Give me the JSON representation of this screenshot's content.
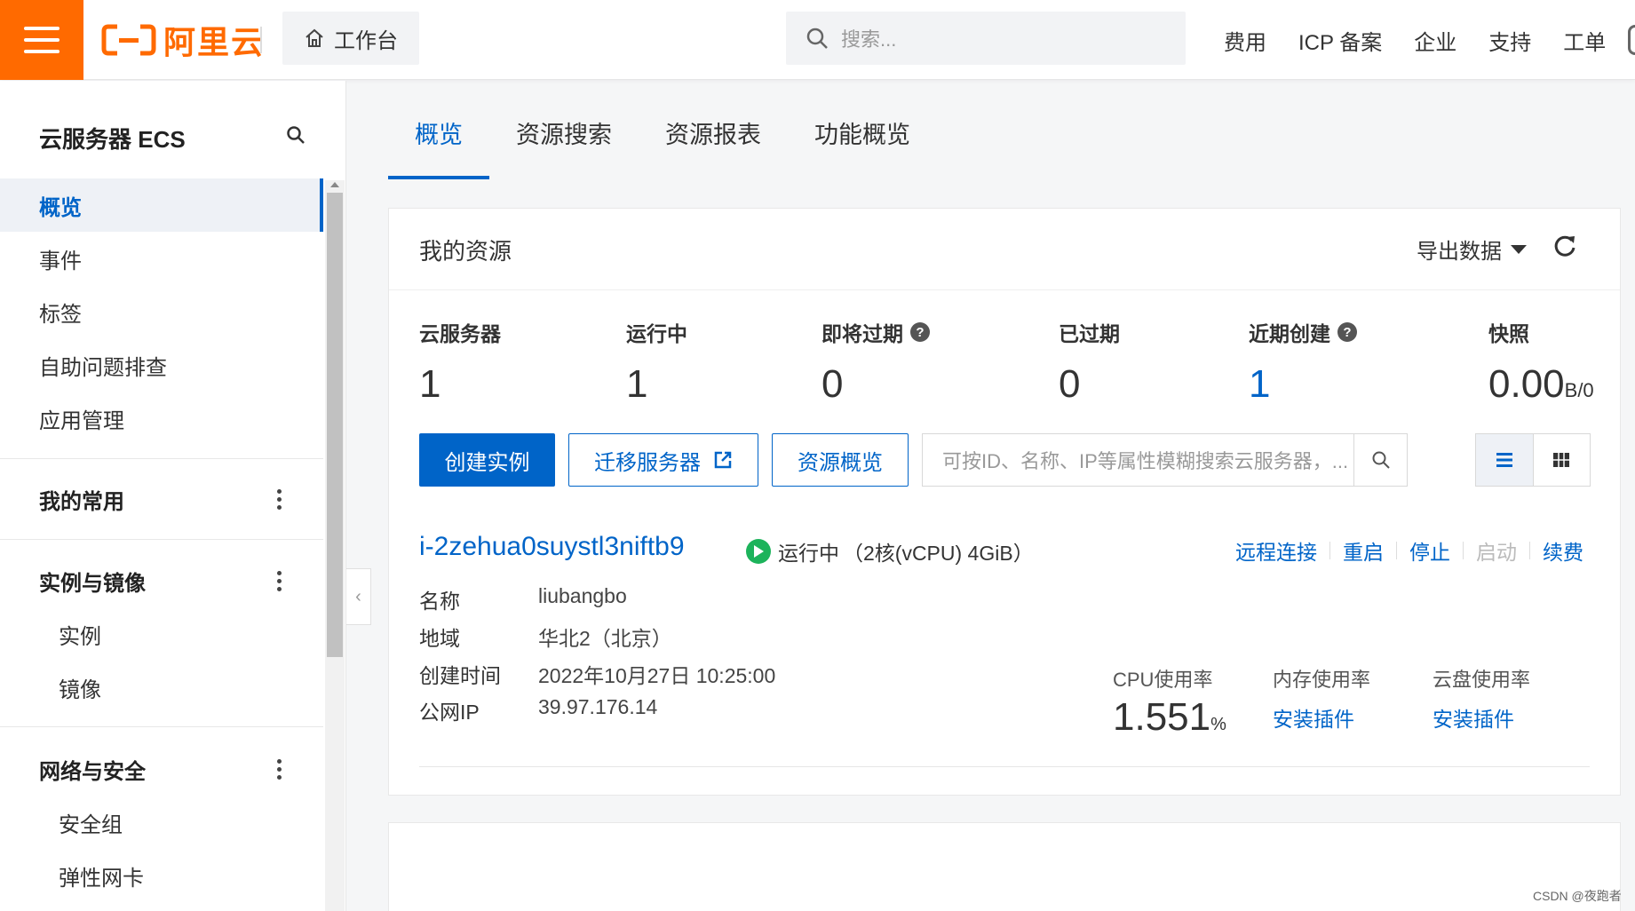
{
  "topbar": {
    "logo_text": "阿里云",
    "workbench_label": "工作台",
    "search_placeholder": "搜索...",
    "nav": [
      "费用",
      "ICP 备案",
      "企业",
      "支持",
      "工单"
    ],
    "brand_color": "#ff6a00"
  },
  "sidebar": {
    "title": "云服务器 ECS",
    "items": [
      "概览",
      "事件",
      "标签",
      "自助问题排查",
      "应用管理"
    ],
    "active_item": "概览",
    "groups": [
      {
        "label": "我的常用",
        "children": []
      },
      {
        "label": "实例与镜像",
        "children": [
          "实例",
          "镜像"
        ]
      },
      {
        "label": "网络与安全",
        "children": [
          "安全组",
          "弹性网卡"
        ]
      }
    ]
  },
  "tabs": [
    "概览",
    "资源搜索",
    "资源报表",
    "功能概览"
  ],
  "active_tab": "概览",
  "resources": {
    "title": "我的资源",
    "export_label": "导出数据",
    "stats": [
      {
        "label": "云服务器",
        "value": "1"
      },
      {
        "label": "运行中",
        "value": "1"
      },
      {
        "label": "即将过期",
        "value": "0",
        "help": "?"
      },
      {
        "label": "已过期",
        "value": "0"
      },
      {
        "label": "近期创建",
        "value": "1",
        "help": "?"
      },
      {
        "label": "快照",
        "value": "0.00",
        "unit": "B/0"
      }
    ],
    "buttons": {
      "create": "创建实例",
      "migrate": "迁移服务器",
      "overview": "资源概览"
    },
    "search_placeholder": "可按ID、名称、IP等属性模糊搜索云服务器，..."
  },
  "instance": {
    "id": "i-2zehua0suystl3niftb9",
    "status": "运行中",
    "spec": "（2核(vCPU) 4GiB）",
    "actions": [
      "远程连接",
      "重启",
      "停止",
      "启动",
      "续费"
    ],
    "fields": [
      {
        "key": "名称",
        "value": "liubangbo"
      },
      {
        "key": "地域",
        "value": "华北2（北京）"
      },
      {
        "key": "创建时间",
        "value": "2022年10月27日 10:25:00"
      },
      {
        "key": "公网IP",
        "value": "39.97.176.14"
      }
    ],
    "metrics": {
      "cpu_label": "CPU使用率",
      "cpu_value": "1.551",
      "cpu_unit": "%",
      "mem_label": "内存使用率",
      "mem_link": "安装插件",
      "disk_label": "云盘使用率",
      "disk_link": "安装插件"
    }
  },
  "credit": "CSDN @夜跑者",
  "accent_color": "#0064c8",
  "status_color": "#1db35b"
}
